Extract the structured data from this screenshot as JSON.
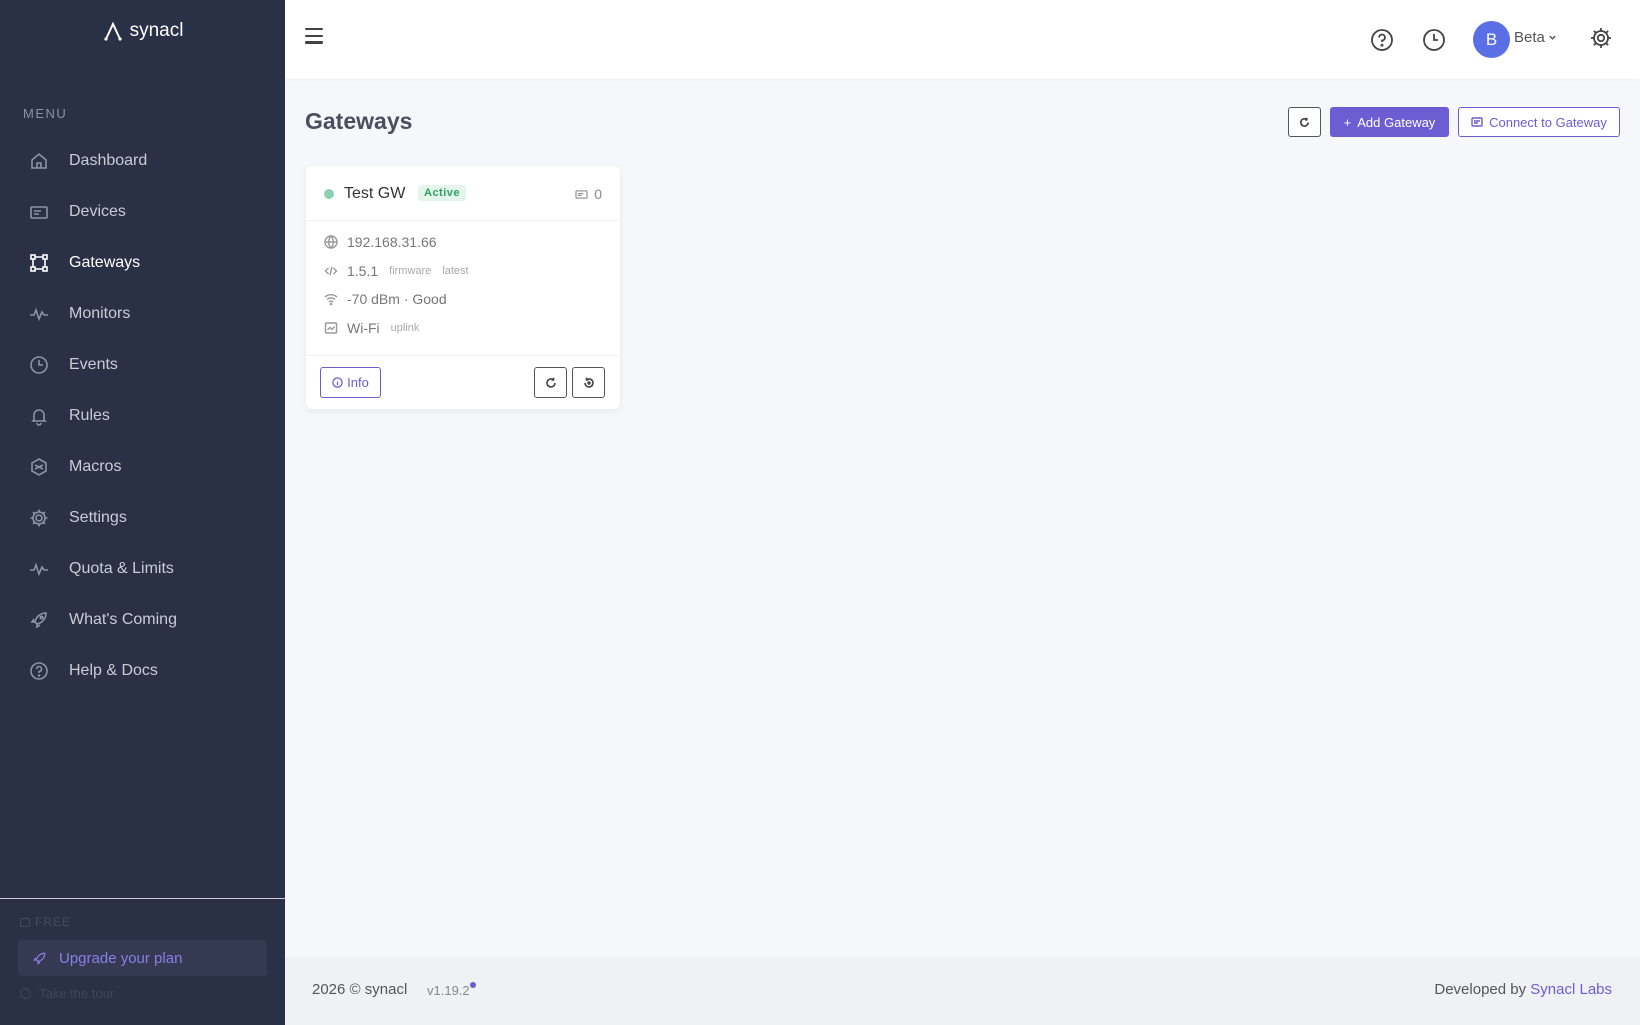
{
  "brand": {
    "name": "synacl"
  },
  "sidebar": {
    "menu_title": "MENU",
    "items": [
      {
        "label": "Dashboard",
        "icon": "home-icon"
      },
      {
        "label": "Devices",
        "icon": "devices-icon"
      },
      {
        "label": "Gateways",
        "icon": "gateway-icon",
        "active": true
      },
      {
        "label": "Monitors",
        "icon": "pulse-icon"
      },
      {
        "label": "Events",
        "icon": "clock-icon"
      },
      {
        "label": "Rules",
        "icon": "bell-icon"
      },
      {
        "label": "Macros",
        "icon": "macro-icon"
      },
      {
        "label": "Settings",
        "icon": "gear-icon"
      },
      {
        "label": "Quota & Limits",
        "icon": "pulse-icon"
      },
      {
        "label": "What's Coming",
        "icon": "rocket-icon"
      },
      {
        "label": "Help & Docs",
        "icon": "help-icon"
      }
    ],
    "plan_label": "FREE",
    "upgrade_label": "Upgrade your plan",
    "tour_label": "Take the tour"
  },
  "topbar": {
    "user_initial": "B",
    "user_name": "Beta"
  },
  "main": {
    "title": "Gateways",
    "add_button": "Add Gateway",
    "connect_button": "Connect to Gateway"
  },
  "gateway_card": {
    "name": "Test GW",
    "status": "Active",
    "device_count": "0",
    "ip": "192.168.31.66",
    "firmware_version": "1.5.1",
    "firmware_tag": "firmware",
    "firmware_status": "latest",
    "signal": "-70 dBm · Good",
    "uplink": "Wi-Fi",
    "uplink_tag": "uplink",
    "info_button": "Info"
  },
  "footer": {
    "copyright": "2026 © synacl",
    "version": "v1.19.2",
    "developed_by": "Developed by ",
    "developer": "Synacl Labs"
  },
  "colors": {
    "sidebar_bg": "#2a3045",
    "accent": "#6c5dd3",
    "avatar": "#5a6ee6",
    "status_active": "#8ed1b0"
  }
}
